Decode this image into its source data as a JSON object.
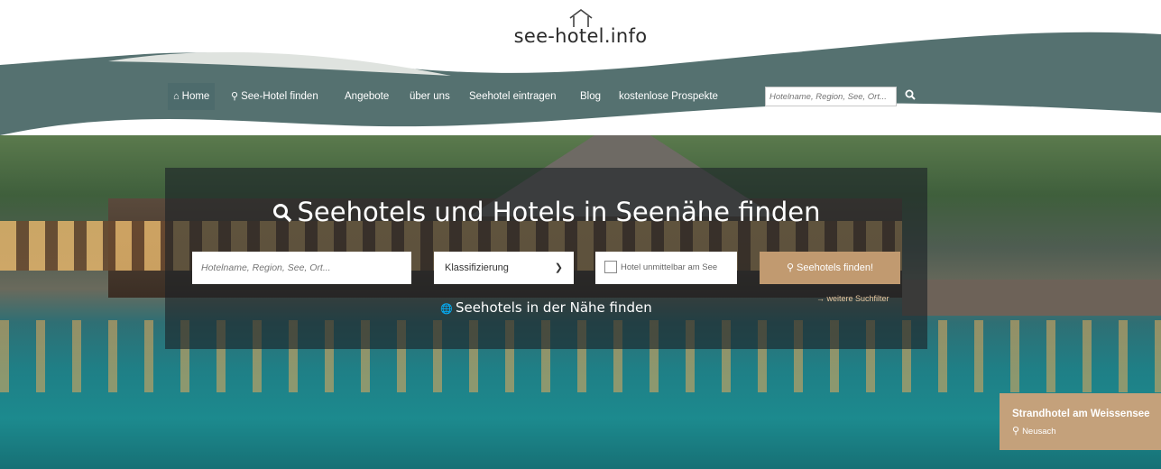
{
  "logo": {
    "text": "see-hotel.info",
    "icon": "house-outline-icon"
  },
  "nav": {
    "items": [
      {
        "label": "Home",
        "icon": "home-icon",
        "active": true
      },
      {
        "label": "See-Hotel finden",
        "icon": "search-icon"
      },
      {
        "label": "Angebote"
      },
      {
        "label": "über uns"
      },
      {
        "label": "Seehotel eintragen"
      },
      {
        "label": "Blog"
      },
      {
        "label": "kostenlose Prospekte"
      }
    ],
    "search_placeholder": "Hotelname, Region, See, Ort..."
  },
  "hero": {
    "title": "Seehotels und Hotels in Seenähe finden",
    "search_placeholder": "Hotelname, Region, See, Ort...",
    "classification_label": "Klassifizierung",
    "lakeside_checkbox_label": "Hotel unmittelbar am See",
    "submit_label": "Seehotels finden!",
    "more_filters_label": "→ weitere Suchfilter",
    "nearby_label": "Seehotels in der Nähe finden"
  },
  "featured": {
    "name": "Strandhotel am Weissensee",
    "location": "Neusach"
  },
  "colors": {
    "nav_bg": "#557170",
    "accent": "#c19a70",
    "panel": "rgba(28,34,38,0.62)"
  }
}
